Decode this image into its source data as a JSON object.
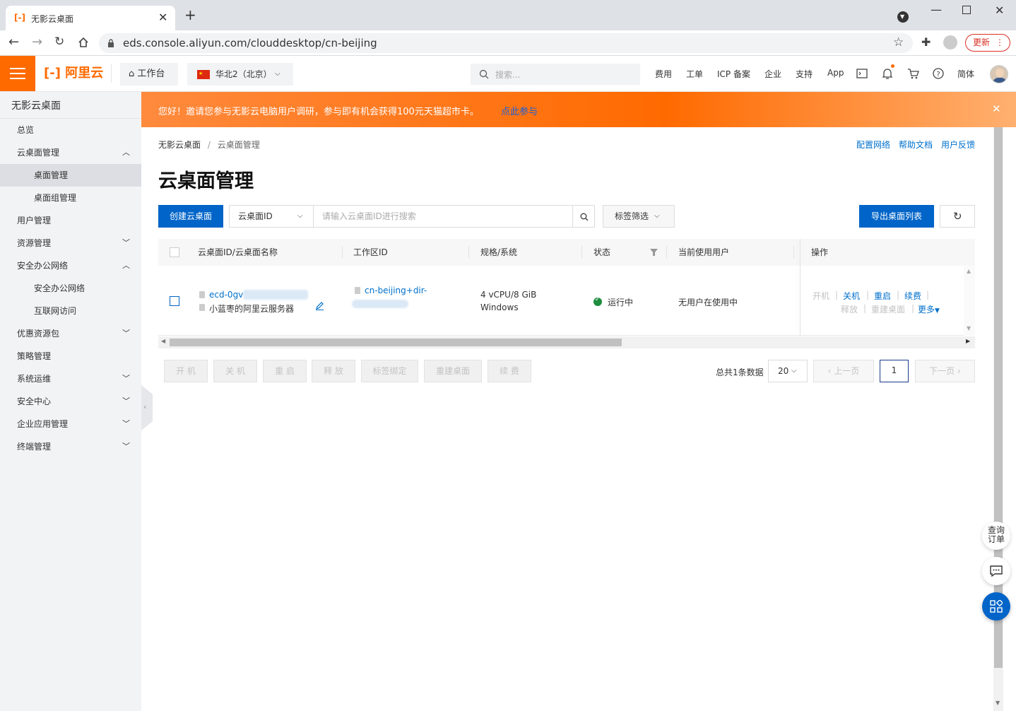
{
  "browser": {
    "tab_title": "无影云桌面",
    "new_tab": "+",
    "url": "eds.console.aliyun.com/clouddesktop/cn-beijing",
    "update_label": "更新"
  },
  "header": {
    "logo_text": "阿里云",
    "workbench": "工作台",
    "region": "华北2（北京）",
    "search_placeholder": "搜索...",
    "nav": [
      "费用",
      "工单",
      "ICP 备案",
      "企业",
      "支持",
      "App"
    ],
    "lang": "简体",
    "accent": "#ff6a00"
  },
  "sidebar": {
    "title": "无影云桌面",
    "items": [
      {
        "label": "总览"
      },
      {
        "label": "云桌面管理"
      },
      {
        "label": "桌面管理"
      },
      {
        "label": "桌面组管理"
      },
      {
        "label": "用户管理"
      },
      {
        "label": "资源管理"
      },
      {
        "label": "安全办公网络"
      },
      {
        "label": "安全办公网络"
      },
      {
        "label": "互联网访问"
      },
      {
        "label": "优惠资源包"
      },
      {
        "label": "策略管理"
      },
      {
        "label": "系统运维"
      },
      {
        "label": "安全中心"
      },
      {
        "label": "企业应用管理"
      },
      {
        "label": "终端管理"
      }
    ]
  },
  "banner": {
    "text": "您好！邀请您参与无影云电脑用户调研，参与即有机会获得100元天猫超市卡。",
    "link": "点此参与"
  },
  "breadcrumb": {
    "root": "无影云桌面",
    "sep": "/",
    "current": "云桌面管理"
  },
  "top_links": [
    "配置网络",
    "帮助文档",
    "用户反馈"
  ],
  "page_title": "云桌面管理",
  "toolbar": {
    "create": "创建云桌面",
    "filter_field": "云桌面ID",
    "search_placeholder": "请输入云桌面ID进行搜索",
    "tag_filter": "标签筛选",
    "export": "导出桌面列表"
  },
  "table": {
    "headers": [
      "云桌面ID/云桌面名称",
      "工作区ID",
      "规格/系统",
      "状态",
      "当前使用用户",
      "操作"
    ],
    "row": {
      "id": "ecd-0gv",
      "name": "小蓝枣的阿里云服务器",
      "workspace": "cn-beijing+dir-",
      "spec": "4 vCPU/8 GiB",
      "os": "Windows",
      "status": "运行中",
      "user": "无用户在使用中",
      "actions": [
        "开机",
        "关机",
        "重启",
        "续费",
        "释放",
        "重建桌面",
        "更多"
      ]
    }
  },
  "batch_buttons": [
    "开 机",
    "关 机",
    "重 启",
    "释 放",
    "标签绑定",
    "重建桌面",
    "续 费"
  ],
  "pagination": {
    "total": "总共1条数据",
    "page_size": "20",
    "prev": "上一页",
    "page": "1",
    "next": "下一页"
  },
  "floating": {
    "order": "查询订单"
  }
}
